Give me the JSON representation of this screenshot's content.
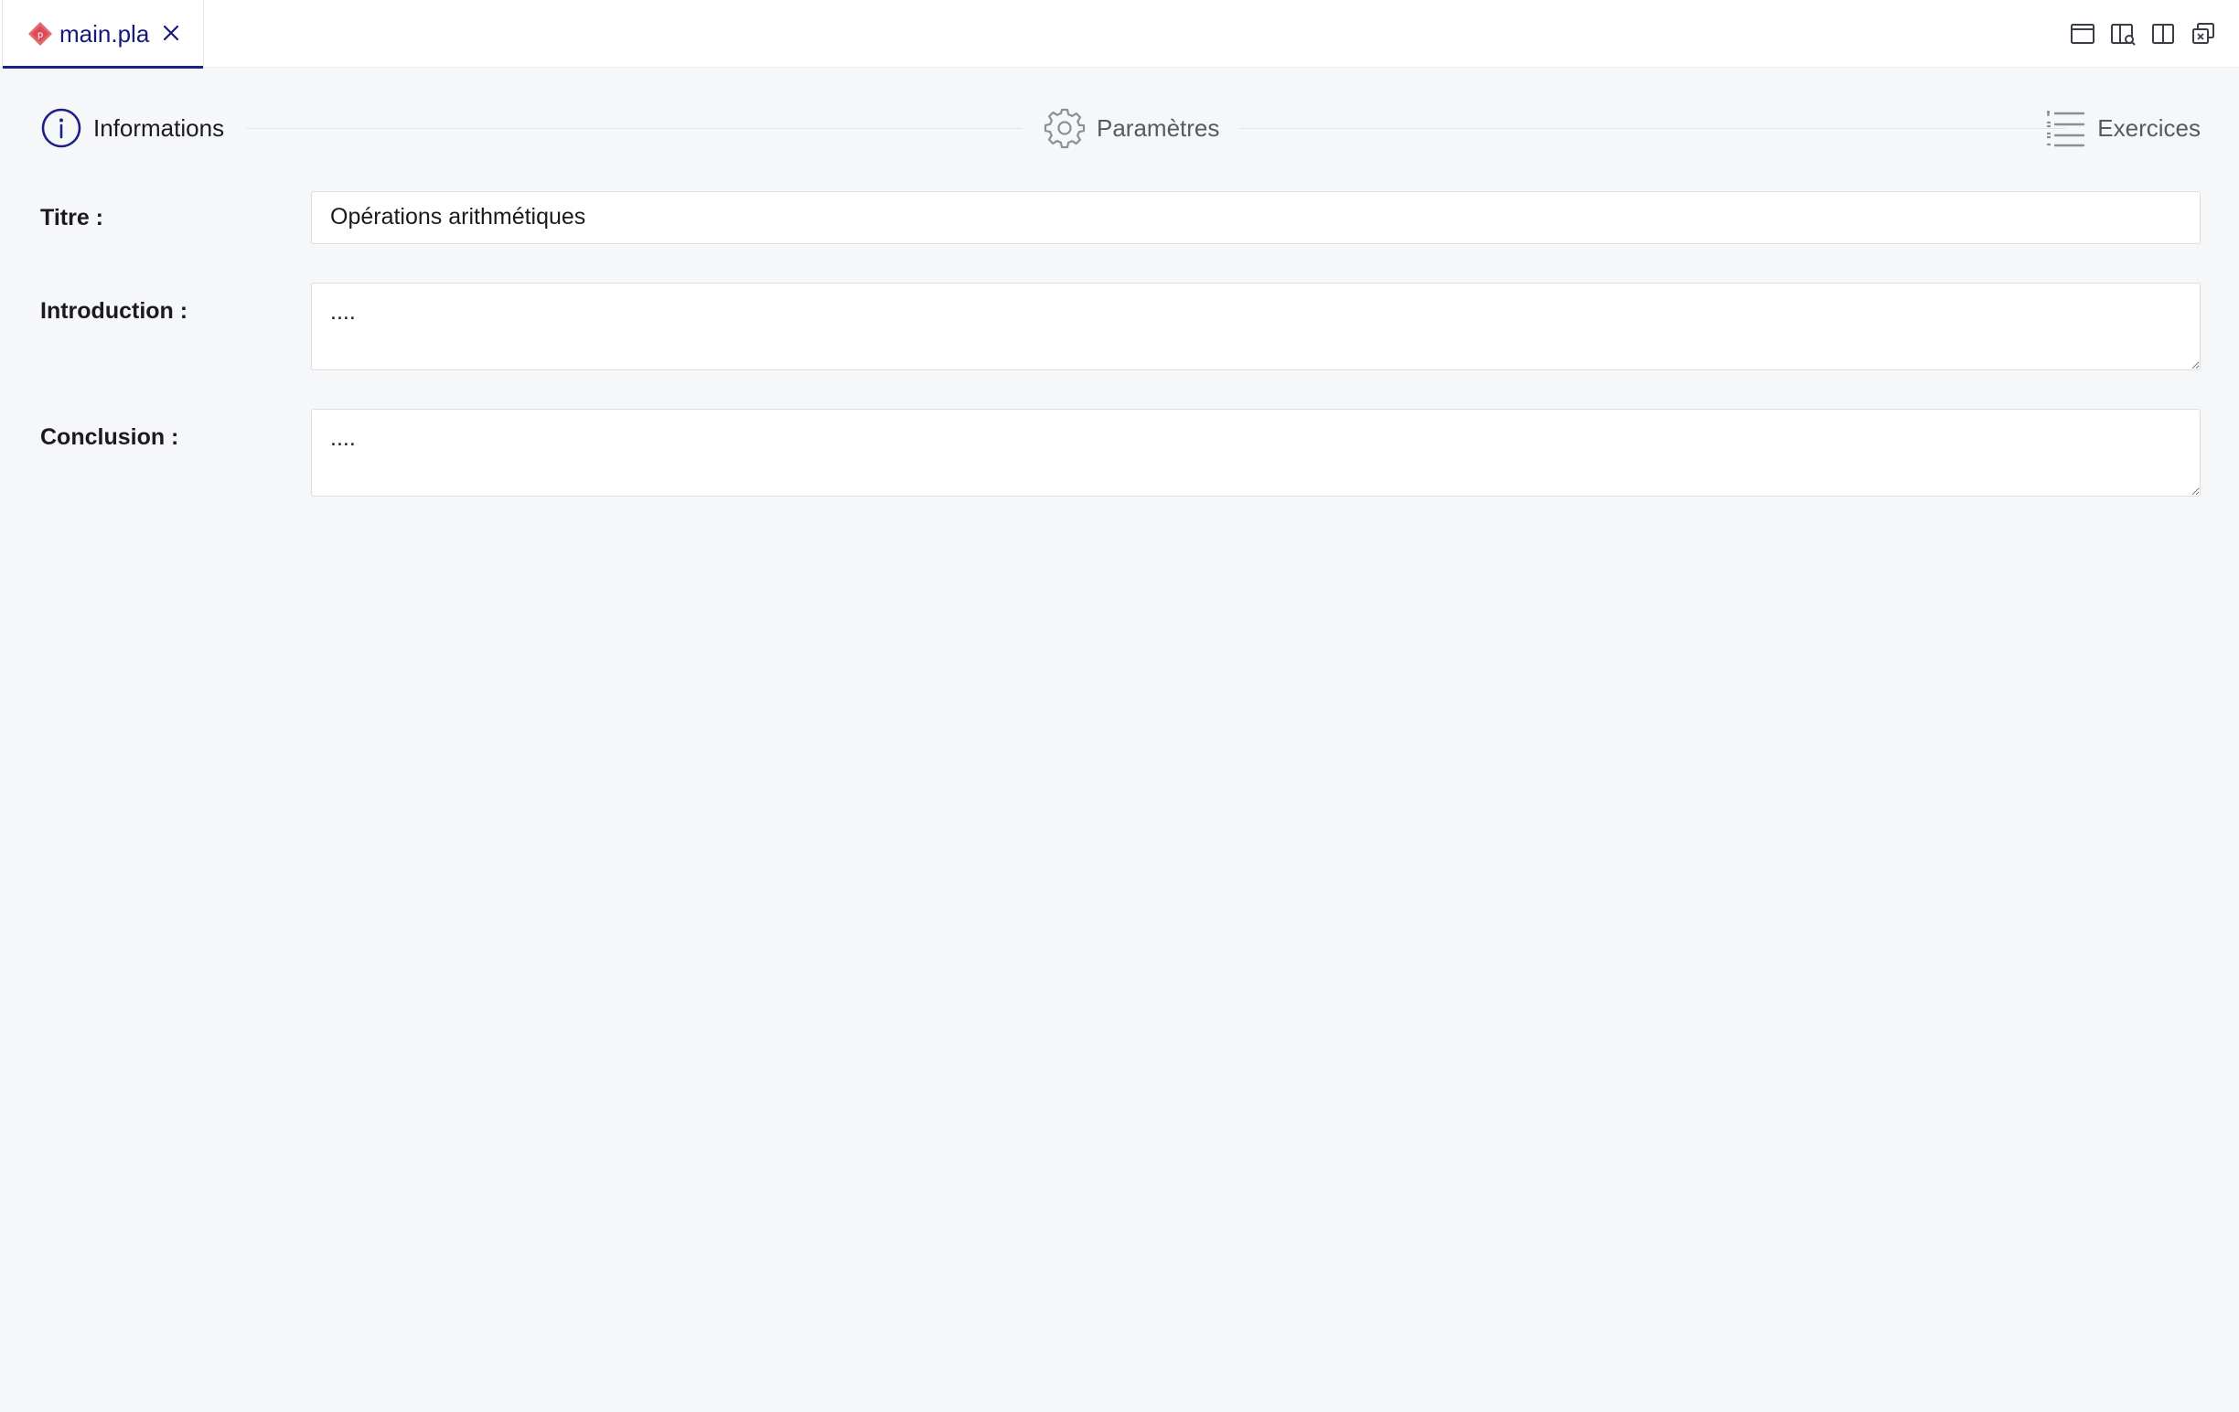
{
  "tabbar": {
    "tab": {
      "label": "main.pla",
      "icon": "pla-file-icon"
    },
    "layout_icons": [
      "single-panel-icon",
      "split-panel-preview-icon",
      "split-columns-icon",
      "close-others-icon"
    ]
  },
  "stepper": {
    "steps": [
      {
        "label": "Informations",
        "icon": "info-circle-icon",
        "state": "active"
      },
      {
        "label": "Paramètres",
        "icon": "gear-icon",
        "state": "inactive"
      },
      {
        "label": "Exercices",
        "icon": "list-icon",
        "state": "inactive"
      }
    ]
  },
  "form": {
    "titre": {
      "label": "Titre :",
      "value": "Opérations arithmétiques"
    },
    "introduction": {
      "label": "Introduction :",
      "value": "...."
    },
    "conclusion": {
      "label": "Conclusion :",
      "value": "...."
    }
  },
  "colors": {
    "accent": "#1d1f8a",
    "background": "#f5f7f9",
    "file_icon": "#e05a5a"
  }
}
